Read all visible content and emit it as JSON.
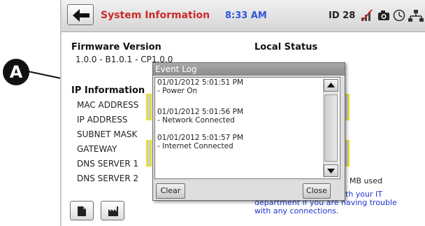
{
  "callout": {
    "label": "A"
  },
  "header": {
    "title": "System Information",
    "time": "8:33 AM",
    "device_id": "ID 28"
  },
  "firmware": {
    "heading": "Firmware Version",
    "value": "1.0.0 - B1.0.1 - CP1.0.0"
  },
  "local_status": {
    "heading": "Local Status"
  },
  "ip_info": {
    "heading": "IP Information",
    "labels": [
      "MAC ADDRESS",
      "IP ADDRESS",
      "SUBNET MASK",
      "GATEWAY",
      "DNS SERVER 1",
      "DNS SERVER 2"
    ]
  },
  "storage": {
    "used_text": "MB used"
  },
  "help_text": {
    "line1": "th your IT",
    "line2": "department if you are having trouble",
    "line3": "with any connections."
  },
  "event_log": {
    "title": "Event Log",
    "entries": [
      {
        "timestamp": "01/01/2012 5:01:51 PM",
        "message": "- Power On"
      },
      {
        "timestamp": "01/01/2012 5:01:56 PM",
        "message": "- Network Connected"
      },
      {
        "timestamp": "01/01/2012 5:01:57 PM",
        "message": "- Internet Connected"
      }
    ],
    "clear_label": "Clear",
    "close_label": "Close"
  },
  "icons": {
    "back": "back-arrow-icon",
    "status": [
      "no-signal-icon",
      "camera-icon",
      "clock-icon",
      "network-icon"
    ],
    "bottom": [
      "document-icon",
      "factory-icon"
    ]
  }
}
